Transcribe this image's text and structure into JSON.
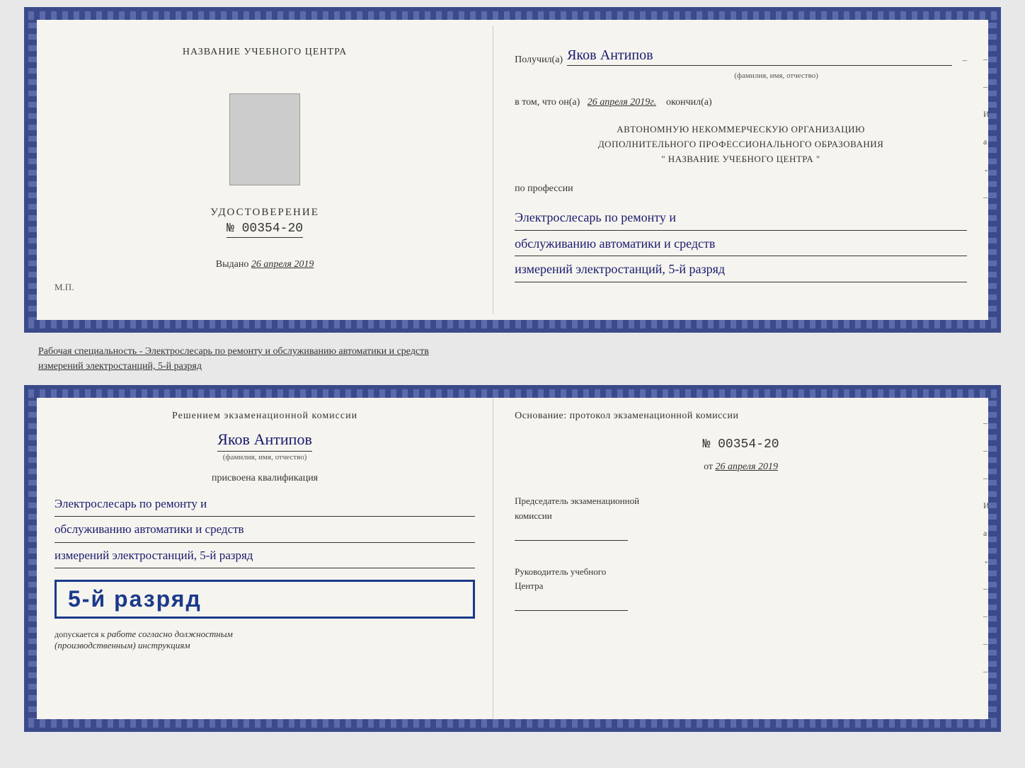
{
  "cert_top": {
    "left": {
      "school_name": "НАЗВАНИЕ УЧЕБНОГО ЦЕНТРА",
      "udostoverenie_title": "УДОСТОВЕРЕНИЕ",
      "number": "№ 00354-20",
      "vydano_label": "Выдано",
      "vydano_date": "26 апреля 2019",
      "mp": "М.П."
    },
    "right": {
      "poluchil_label": "Получил(а)",
      "name_handwritten": "Яков Антипов",
      "name_sublabel": "(фамилия, имя, отчество)",
      "vtom_label": "в том, что он(а)",
      "date_handwritten": "26 апреля 2019г.",
      "okonchil_label": "окончил(а)",
      "org_line1": "АВТОНОМНУЮ НЕКОММЕРЧЕСКУЮ ОРГАНИЗАЦИЮ",
      "org_line2": "ДОПОЛНИТЕЛЬНОГО ПРОФЕССИОНАЛЬНОГО ОБРАЗОВАНИЯ",
      "org_line3": "\"  НАЗВАНИЕ УЧЕБНОГО ЦЕНТРА  \"",
      "po_professii": "по профессии",
      "profession_line1": "Электрослесарь по ремонту и",
      "profession_line2": "обслуживанию автоматики и средств",
      "profession_line3": "измерений электростанций, 5-й разряд"
    }
  },
  "middle_text": {
    "line1": "Рабочая специальность - Электрослесарь по ремонту и обслуживанию автоматики и средств",
    "line2": "измерений электростанций, 5-й разряд"
  },
  "cert_bottom": {
    "left": {
      "resheniem": "Решением экзаменационной комиссии",
      "name_handwritten": "Яков Антипов",
      "name_sublabel": "(фамилия, имя, отчество)",
      "prisvoena": "присвоена квалификация",
      "qual_line1": "Электрослесарь по ремонту и",
      "qual_line2": "обслуживанию автоматики и средств",
      "qual_line3": "измерений электростанций, 5-й разряд",
      "razryad_badge": "5-й разряд",
      "dopuskaetsya_label": "допускается к",
      "dopuskaetsya_hw": "работе согласно должностным",
      "dopuskaetsya_hw2": "(производственным) инструкциям"
    },
    "right": {
      "osnovanie_label": "Основание: протокол экзаменационной комиссии",
      "protocol_num": "№  00354-20",
      "ot_label": "от",
      "ot_date": "26 апреля 2019",
      "predsedatel_title": "Председатель экзаменационной",
      "predsedatel_subtitle": "комиссии",
      "rukovoditel_title": "Руководитель учебного",
      "rukovoditel_subtitle": "Центра"
    }
  },
  "side_labels": {
    "items": [
      "–",
      "–",
      "И",
      "а",
      "←",
      "–",
      "–",
      "–",
      "–"
    ]
  }
}
